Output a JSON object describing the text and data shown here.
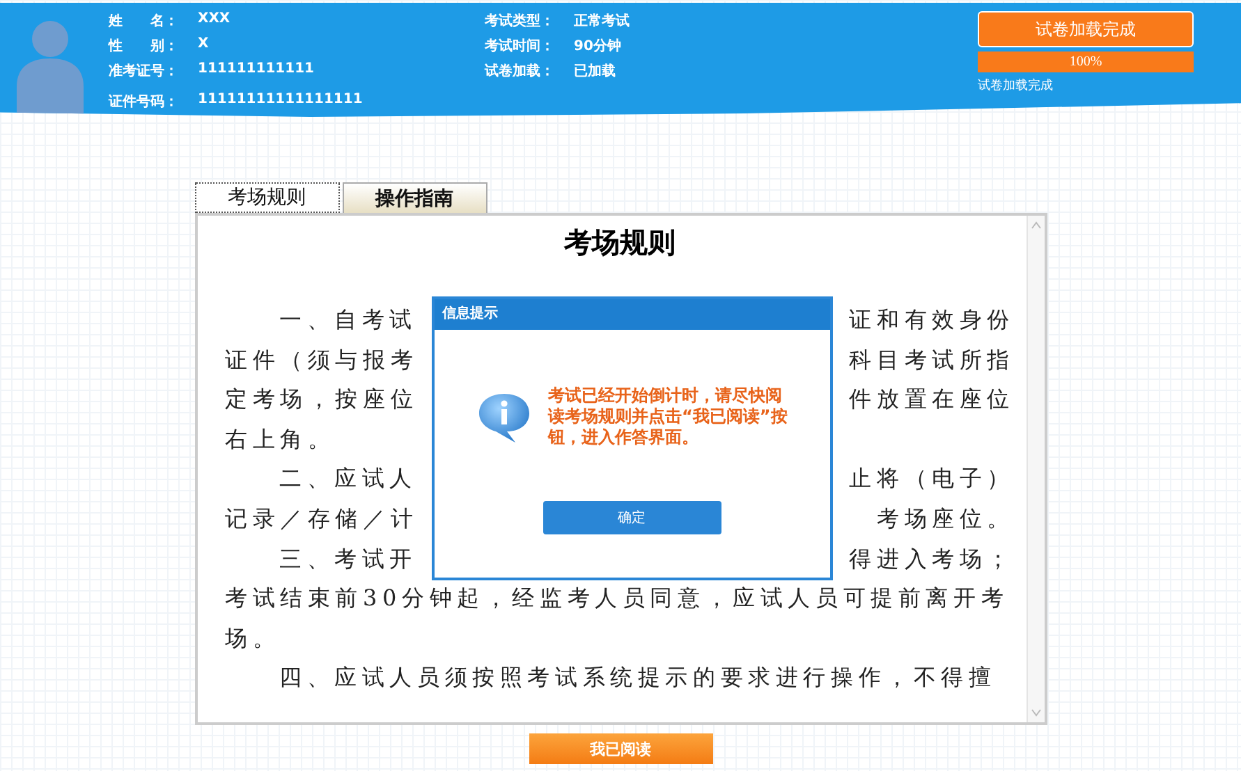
{
  "candidate": {
    "fields": [
      {
        "label": "姓　　名：",
        "value": "XXX"
      },
      {
        "label": "性　　别：",
        "value": "X"
      },
      {
        "label": "准考证号：",
        "value": "111111111111"
      },
      {
        "label": "证件号码：",
        "value": "11111111111111111"
      }
    ]
  },
  "exam": {
    "fields": [
      {
        "label": "考试类型：",
        "value": "正常考试"
      },
      {
        "label": "考试时间：",
        "value": "90分钟"
      },
      {
        "label": "试卷加载：",
        "value": "已加载"
      }
    ]
  },
  "load_status": {
    "button": "试卷加载完成",
    "progress": {
      "level": 1,
      "text": "100%"
    },
    "message": "试卷加载完成"
  },
  "tabs": [
    {
      "label": "考场规则",
      "selected": true
    },
    {
      "label": "操作指南",
      "selected": false
    }
  ],
  "rules": {
    "title": "考场规则",
    "lines": [
      {
        "indent": true,
        "left": "一、自考试",
        "right": "证和有效身份"
      },
      {
        "indent": false,
        "left": "证件（须与报考",
        "right": "科目考试所指"
      },
      {
        "indent": false,
        "left": "定考场，按座位",
        "right": "件放置在座位"
      },
      {
        "indent": false,
        "left": "右上角。"
      },
      {
        "indent": true,
        "left": "二、应试人",
        "right": "止将（电子）"
      },
      {
        "indent": false,
        "left": "记录／存储／计",
        "right": "考场座位。"
      },
      {
        "indent": true,
        "left": "三、考试开",
        "right": "得进入考场；"
      },
      {
        "indent": false,
        "left": "考试结束前30分钟起，经监考人员同意，应试人员可提前离开考"
      },
      {
        "indent": false,
        "left": "场。"
      },
      {
        "indent": true,
        "left": "四、应试人员须按照考试系统提示的要求进行操作，不得擅"
      }
    ]
  },
  "dialog": {
    "title": "信息提示",
    "message": "考试已经开始倒计时，请尽快阅读考场规则并点击“我已阅读”按钮，进入作答界面。",
    "button": "确定"
  },
  "read_button": "我已阅读"
}
